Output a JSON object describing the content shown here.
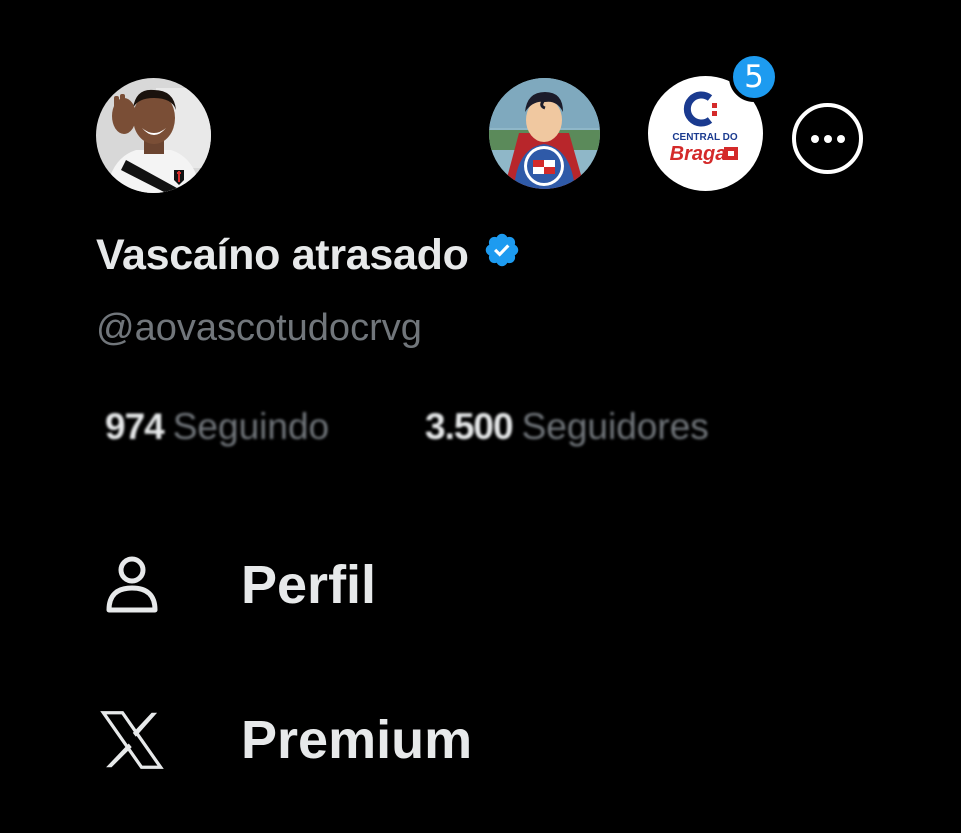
{
  "profile": {
    "display_name": "Vascaíno atrasado",
    "handle": "@aovascotudocrvg",
    "following_count": "974",
    "following_label": "Seguindo",
    "followers_count": "3.500",
    "followers_label": "Seguidores"
  },
  "accounts": {
    "notification_badge": "5",
    "alt_account_2_logo_text": "CENTRAL DO Braga"
  },
  "menu": {
    "items": [
      {
        "label": "Perfil",
        "icon": "person-icon"
      },
      {
        "label": "Premium",
        "icon": "x-logo-icon"
      }
    ]
  },
  "colors": {
    "background": "#000000",
    "primary_text": "#e7e9ea",
    "secondary_text": "#71767b",
    "accent": "#1d9bf0"
  }
}
